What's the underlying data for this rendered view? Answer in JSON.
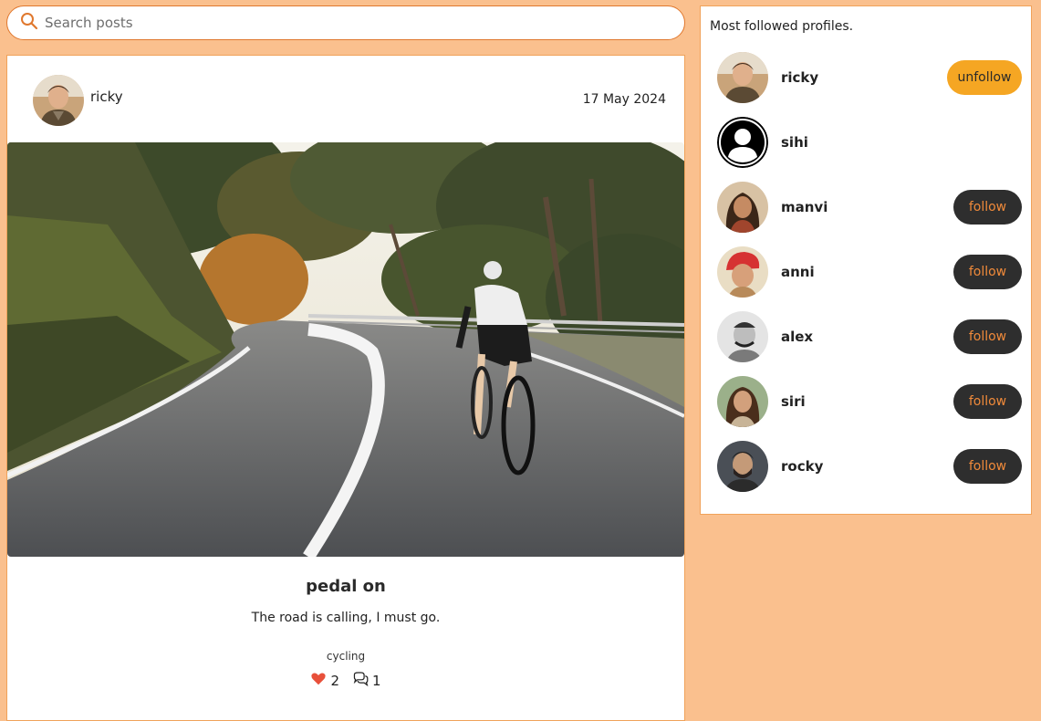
{
  "search": {
    "placeholder": "Search posts"
  },
  "post": {
    "author": "ricky",
    "date": "17 May 2024",
    "title": "pedal on",
    "body": "The road is calling, I must go.",
    "tag": "cycling",
    "likes": "2",
    "comments": "1"
  },
  "sidebar": {
    "title": "Most followed profiles.",
    "profiles": [
      {
        "name": "ricky",
        "button": "unfollow"
      },
      {
        "name": "sihi",
        "button": ""
      },
      {
        "name": "manvi",
        "button": "follow"
      },
      {
        "name": "anni",
        "button": "follow"
      },
      {
        "name": "alex",
        "button": "follow"
      },
      {
        "name": "siri",
        "button": "follow"
      },
      {
        "name": "rocky",
        "button": "follow"
      }
    ]
  },
  "colors": {
    "page_background": "#fac08e",
    "accent_border": "#f0a25a",
    "follow_button": "#2e2e2e",
    "follow_text": "#f08a3a",
    "unfollow_button": "#f5a623",
    "like_heart": "#e8503a"
  },
  "icons": {
    "search": "search-icon",
    "like": "heart-icon",
    "comments": "comments-icon"
  }
}
